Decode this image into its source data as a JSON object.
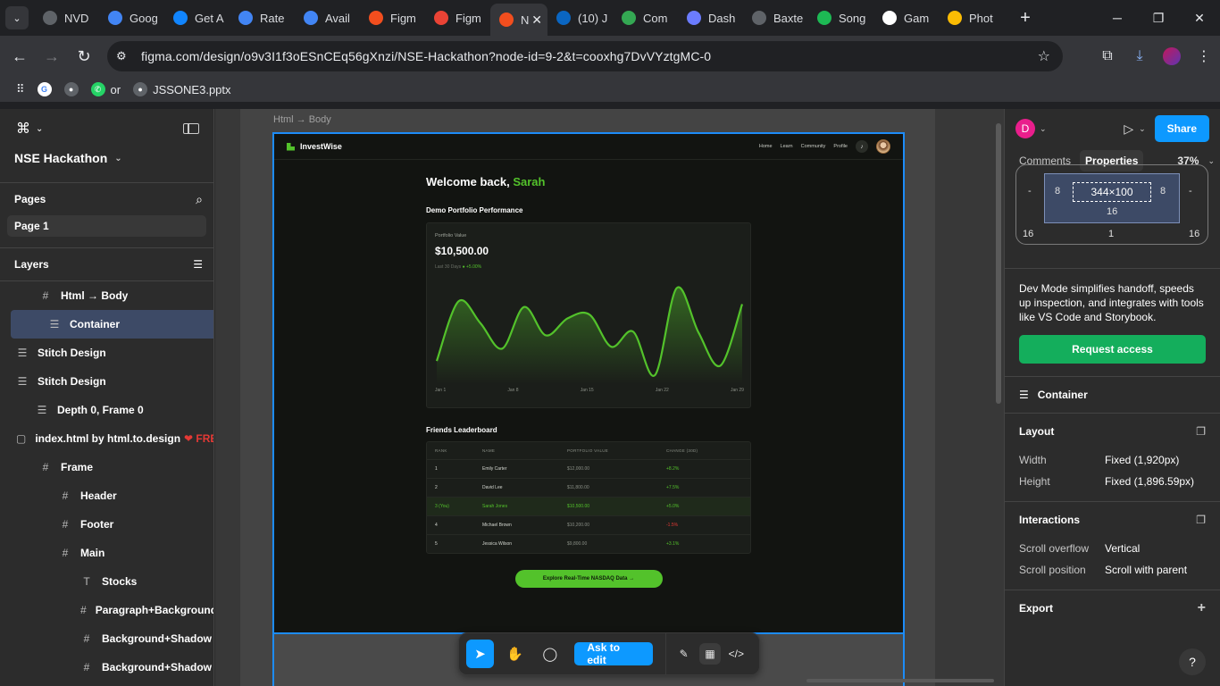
{
  "browser": {
    "tabs": [
      {
        "title": "NVD",
        "icon": "globe-icon",
        "color": "#5f6368"
      },
      {
        "title": "Goog",
        "icon": "gemini-icon",
        "color": "#4285f4"
      },
      {
        "title": "Get A",
        "icon": "bluesky-icon",
        "color": "#1185fe"
      },
      {
        "title": "Rate",
        "icon": "google-icon",
        "color": "#4285f4"
      },
      {
        "title": "Avail",
        "icon": "google-icon",
        "color": "#4285f4"
      },
      {
        "title": "Figm",
        "icon": "figma-icon",
        "color": "#f24e1e"
      },
      {
        "title": "Figm",
        "icon": "gmail-icon",
        "color": "#ea4335"
      },
      {
        "title": "N",
        "icon": "figma-icon",
        "color": "#f24e1e",
        "active": true
      },
      {
        "title": "(10) J",
        "icon": "linkedin-icon",
        "color": "#0a66c2"
      },
      {
        "title": "Com",
        "icon": "cloud-icon",
        "color": "#34a853"
      },
      {
        "title": "Dash",
        "icon": "dashboard-icon",
        "color": "#6b7cff"
      },
      {
        "title": "Baxte",
        "icon": "globe-icon",
        "color": "#5f6368"
      },
      {
        "title": "Song",
        "icon": "spotify-icon",
        "color": "#1db954"
      },
      {
        "title": "Gam",
        "icon": "play-icon",
        "color": "#ffffff"
      },
      {
        "title": "Phot",
        "icon": "photos-icon",
        "color": "#fbbc04"
      }
    ],
    "url": "figma.com/design/o9v3I1f3oESnCEq56gXnzi/NSE-Hackathon?node-id=9-2&t=cooxhg7DvVYztgMC-0",
    "bookmarks": [
      {
        "label": "",
        "icon": "google-icon"
      },
      {
        "label": "",
        "icon": "globe-icon"
      },
      {
        "label": "or",
        "icon": "whatsapp-icon"
      },
      {
        "label": "JSSONE3.pptx",
        "icon": "globe-icon"
      }
    ]
  },
  "figma": {
    "file_name": "NSE Hackathon",
    "pages_label": "Pages",
    "page": "Page 1",
    "layers_label": "Layers",
    "layers": [
      {
        "name": "Html → Body",
        "indent": 44,
        "icon": "#"
      },
      {
        "name": "Container",
        "indent": 54,
        "icon": "☰",
        "selected": true
      },
      {
        "name": "Stitch Design",
        "indent": 18,
        "icon": "☰"
      },
      {
        "name": "Stitch Design",
        "indent": 18,
        "icon": "☰"
      },
      {
        "name": "Depth 0, Frame 0",
        "indent": 40,
        "icon": "☰"
      },
      {
        "name": "index.html by html.to.design",
        "indent": 18,
        "icon": "▢",
        "heart": "❤ FREE"
      },
      {
        "name": "Frame",
        "indent": 44,
        "icon": "#"
      },
      {
        "name": "Header",
        "indent": 66,
        "icon": "#"
      },
      {
        "name": "Footer",
        "indent": 66,
        "icon": "#"
      },
      {
        "name": "Main",
        "indent": 66,
        "icon": "#"
      },
      {
        "name": "Stocks",
        "indent": 90,
        "icon": "T"
      },
      {
        "name": "Paragraph+Background+",
        "indent": 90,
        "icon": "#"
      },
      {
        "name": "Background+Shadow",
        "indent": 90,
        "icon": "#"
      },
      {
        "name": "Background+Shadow",
        "indent": 90,
        "icon": "#"
      }
    ],
    "frame_label": "Html → Body",
    "toolbar": {
      "ask_label": "Ask to edit"
    },
    "right": {
      "user_initial": "D",
      "share_label": "Share",
      "tab_comments": "Comments",
      "tab_properties": "Properties",
      "zoom": "37%",
      "box": {
        "content": "344×100",
        "pad_left": "8",
        "pad_right": "8",
        "pad_bottom": "16",
        "margin_left": "16",
        "margin_bottom": "1",
        "margin_right": "16",
        "dash_left": "-",
        "dash_right": "-"
      },
      "dev_text": "Dev Mode simplifies handoff, speeds up inspection, and integrates with tools like VS Code and Storybook.",
      "request_label": "Request access",
      "selection_name": "Container",
      "layout_label": "Layout",
      "width_key": "Width",
      "width_val": "Fixed (1,920px)",
      "height_key": "Height",
      "height_val": "Fixed (1,896.59px)",
      "interactions_label": "Interactions",
      "overflow_key": "Scroll overflow",
      "overflow_val": "Vertical",
      "position_key": "Scroll position",
      "position_val": "Scroll with parent",
      "export_label": "Export",
      "help": "?"
    }
  },
  "app": {
    "brand": "InvestWise",
    "nav": [
      "Home",
      "Learn",
      "Community",
      "Profile"
    ],
    "welcome": "Welcome back,",
    "user": "Sarah",
    "perf_title": "Demo Portfolio Performance",
    "pv_label": "Portfolio Value",
    "pv_value": "$10,500.00",
    "pv_period": "Last 30 Days",
    "pv_change": "+5.00%",
    "leader_title": "Friends Leaderboard",
    "table_headers": [
      "RANK",
      "NAME",
      "PORTFOLIO VALUE",
      "CHANGE (30D)"
    ],
    "rows": [
      {
        "rank": "1",
        "name": "Emily Carter",
        "value": "$12,000.00",
        "change": "+8.2%",
        "neg": false
      },
      {
        "rank": "2",
        "name": "David Lee",
        "value": "$11,800.00",
        "change": "+7.5%",
        "neg": false
      },
      {
        "rank": "3 (You)",
        "name": "Sarah Jones",
        "value": "$10,500.00",
        "change": "+5.0%",
        "neg": false,
        "you": true
      },
      {
        "rank": "4",
        "name": "Michael Brown",
        "value": "$10,200.00",
        "change": "-1.5%",
        "neg": true
      },
      {
        "rank": "5",
        "name": "Jessica Wilson",
        "value": "$9,800.00",
        "change": "+3.1%",
        "neg": false
      }
    ],
    "cta": "Explore Real-Time NASDAQ Data →"
  },
  "chart_data": {
    "type": "area",
    "x": [
      "Jan 1",
      "Jan 8",
      "Jan 15",
      "Jan 22",
      "Jan 29"
    ],
    "x_ticks": [
      "Jan 1",
      "Jan 8",
      "Jan 15",
      "Jan 22",
      "Jan 29"
    ],
    "values": [
      0.15,
      0.78,
      0.55,
      0.28,
      0.72,
      0.42,
      0.6,
      0.64,
      0.3,
      0.46,
      0.0,
      0.92,
      0.45,
      0.1,
      0.75
    ],
    "line_color": "#53c22b",
    "grid": false
  }
}
